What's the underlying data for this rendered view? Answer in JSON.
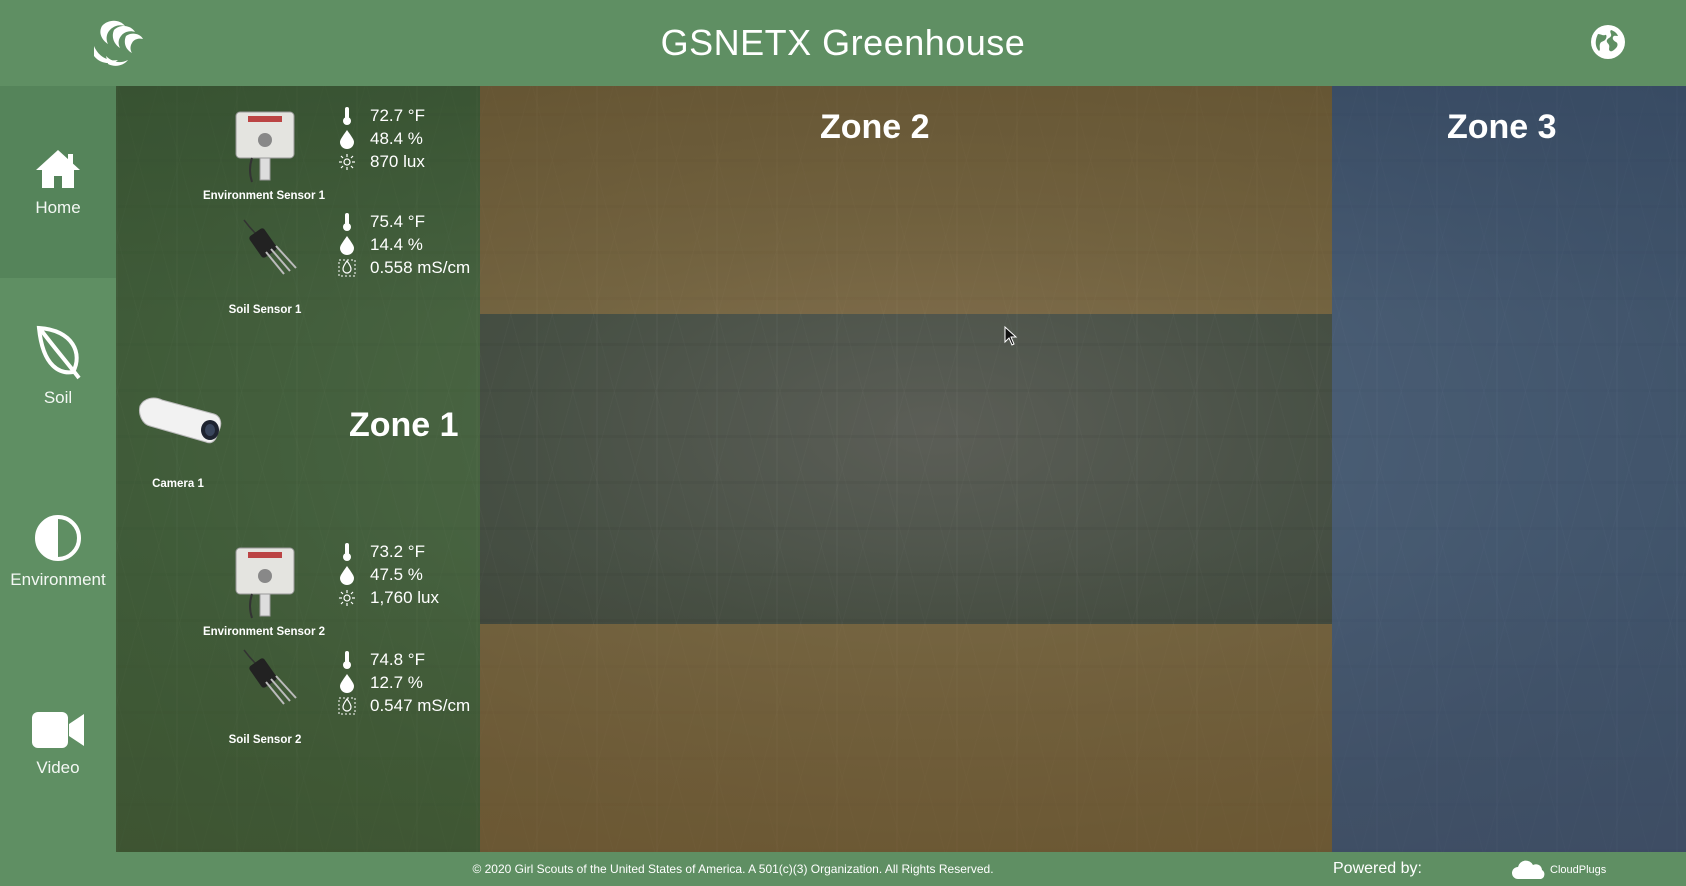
{
  "app": {
    "title": "GSNETX Greenhouse"
  },
  "sidebar": {
    "items": [
      {
        "label": "Home",
        "icon": "home-icon"
      },
      {
        "label": "Soil",
        "icon": "leaf-icon"
      },
      {
        "label": "Environment",
        "icon": "half-circle-icon"
      },
      {
        "label": "Video",
        "icon": "video-camera-icon"
      }
    ]
  },
  "zones": {
    "zone1": "Zone 1",
    "zone2": "Zone 2",
    "zone3": "Zone 3"
  },
  "devices": {
    "env1": {
      "name": "Environment Sensor 1",
      "temperature": "72.7 °F",
      "humidity": "48.4 %",
      "light": "870 lux"
    },
    "soil1": {
      "name": "Soil Sensor 1",
      "temperature": "75.4 °F",
      "moisture": "14.4 %",
      "conductivity": "0.558 mS/cm"
    },
    "camera1": {
      "name": "Camera 1"
    },
    "env2": {
      "name": "Environment Sensor 2",
      "temperature": "73.2 °F",
      "humidity": "47.5 %",
      "light": "1,760 lux"
    },
    "soil2": {
      "name": "Soil Sensor 2",
      "temperature": "74.8 °F",
      "moisture": "12.7 %",
      "conductivity": "0.547 mS/cm"
    }
  },
  "footer": {
    "copyright": "© 2020 Girl Scouts of the United States of America. A 501(c)(3) Organization. All Rights Reserved.",
    "powered_by": "Powered by:",
    "brand": "CloudPlugs"
  },
  "colors": {
    "brand_green": "#5f8f63",
    "zone1_tint": "#466e3c",
    "zone2_tint": "#96703c",
    "zone3_tint": "#465f96"
  }
}
